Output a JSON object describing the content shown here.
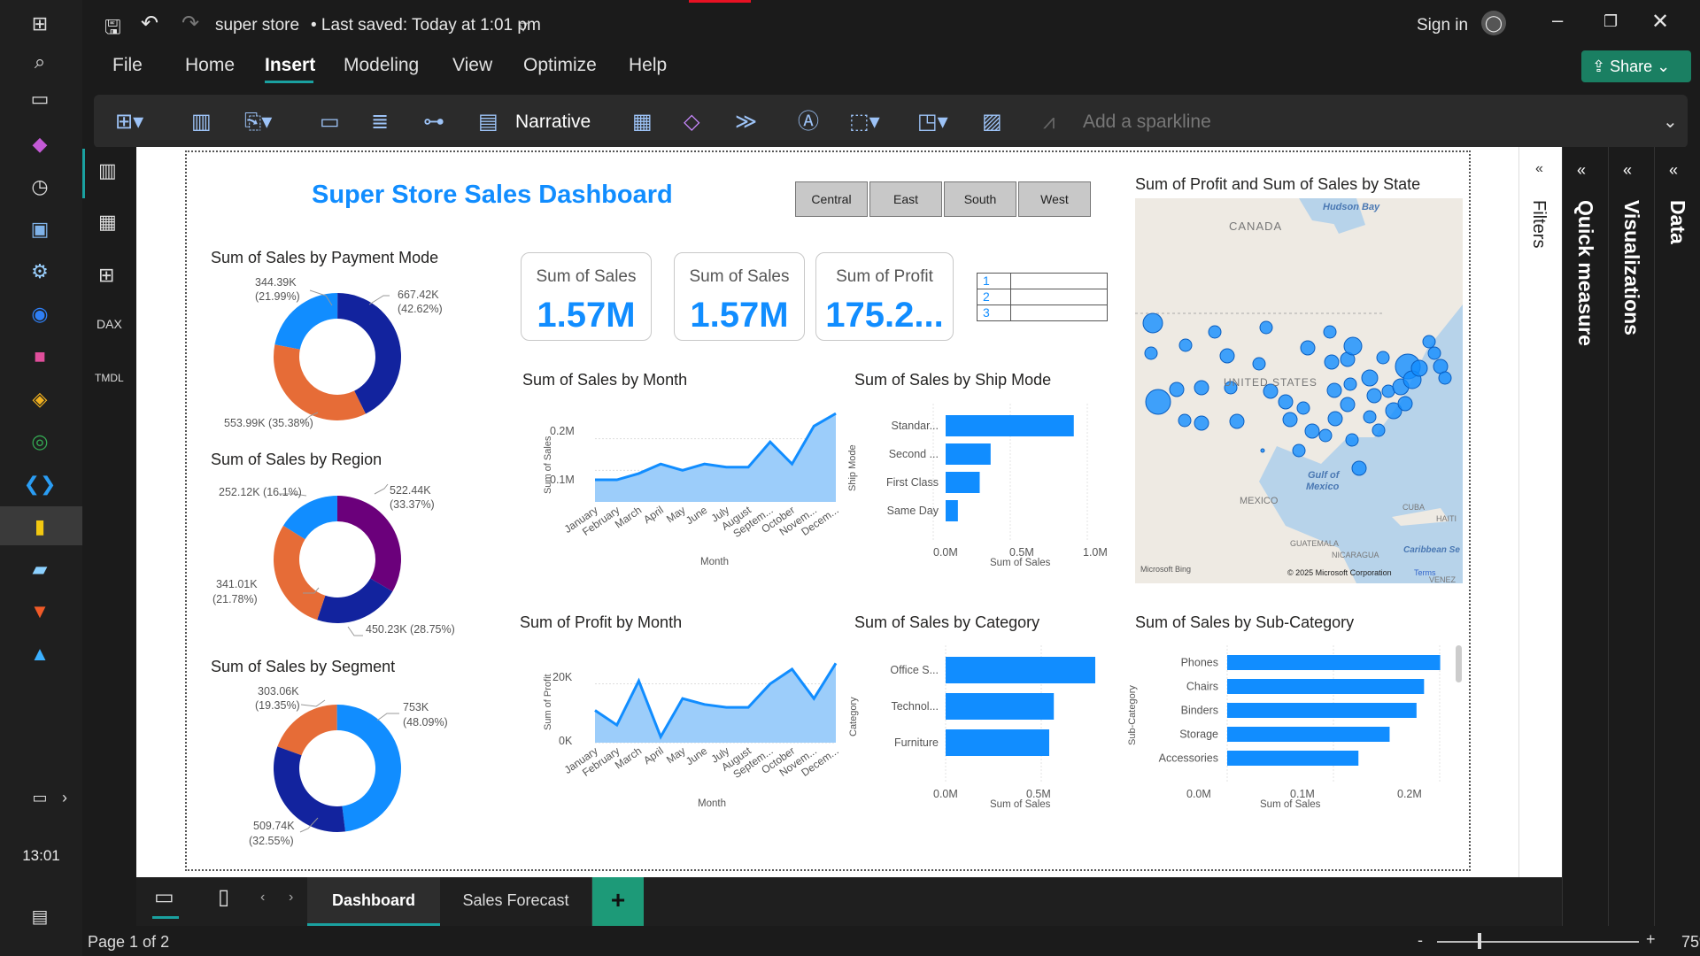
{
  "window": {
    "file_name": "super store",
    "saved_status": "• Last saved: Today at 1:01 pm",
    "sign_in": "Sign in",
    "share": "Share"
  },
  "menu": [
    "File",
    "Home",
    "Insert",
    "Modeling",
    "View",
    "Optimize",
    "Help"
  ],
  "ribbon": {
    "narrative": "Narrative",
    "sparkline": "Add a sparkline"
  },
  "taskbar": {
    "time": "13:01"
  },
  "panes": {
    "filters": "Filters",
    "quick_measure": "Quick measure",
    "visualizations": "Visualizations",
    "data": "Data"
  },
  "report": {
    "title": "Super Store Sales Dashboard",
    "slicer": [
      "Central",
      "East",
      "South",
      "West"
    ],
    "kpis": [
      {
        "label": "Sum of Sales",
        "value": "1.57M"
      },
      {
        "label": "Sum of Sales",
        "value": "1.57M"
      },
      {
        "label": "Sum of Profit",
        "value": "175.2..."
      }
    ],
    "table_rows": [
      "1",
      "2",
      "3"
    ],
    "payment": {
      "title": "Sum of Sales by Payment Mode",
      "labels": [
        "344.39K",
        "(21.99%)",
        "667.42K",
        "(42.62%)",
        "553.99K (35.38%)"
      ]
    },
    "region": {
      "title": "Sum of Sales by Region",
      "labels": [
        "252.12K (16.1%)",
        "522.44K",
        "(33.37%)",
        "341.01K",
        "(21.78%)",
        "450.23K (28.75%)"
      ]
    },
    "segment": {
      "title": "Sum of Sales by Segment",
      "labels": [
        "303.06K",
        "(19.35%)",
        "753K",
        "(48.09%)",
        "509.74K",
        "(32.55%)"
      ]
    },
    "sales_month": {
      "title": "Sum of Sales by Month",
      "ylabel": "Sum of Sales",
      "xlabel": "Month",
      "yticks": [
        "0.2M",
        "0.1M"
      ]
    },
    "profit_month": {
      "title": "Sum of Profit by Month",
      "ylabel": "Sum of Profit",
      "xlabel": "Month",
      "yticks": [
        "20K",
        "0K"
      ]
    },
    "ship": {
      "title": "Sum of Sales by Ship Mode",
      "ylabel": "Ship Mode",
      "xlabel": "Sum of Sales",
      "xticks": [
        "0.0M",
        "0.5M",
        "1.0M"
      ]
    },
    "category": {
      "title": "Sum of Sales by Category",
      "ylabel": "Category",
      "xlabel": "Sum of Sales",
      "xticks": [
        "0.0M",
        "0.5M"
      ]
    },
    "subcat": {
      "title": "Sum of Sales by Sub-Category",
      "ylabel": "Sub-Category",
      "xlabel": "Sum of Sales",
      "xticks": [
        "0.0M",
        "0.1M",
        "0.2M"
      ]
    },
    "map": {
      "title": "Sum of Profit and Sum of Sales by State",
      "labels": [
        "Hudson Bay",
        "CANADA",
        "UNITED STATES",
        "Gulf of",
        "Mexico",
        "MEXICO",
        "CUBA",
        "GUATEMALA",
        "NICARAGUA",
        "Caribbean Se",
        "VENEZ",
        "Microsoft Bing",
        "© 2025 Microsoft Corporation",
        "Terms",
        "HAITI"
      ]
    }
  },
  "tabs": [
    "Dashboard",
    "Sales Forecast"
  ],
  "status": {
    "page": "Page 1 of 2",
    "zoom": "75%",
    "zoom_minus": "-",
    "zoom_plus": "+"
  },
  "chart_data": [
    {
      "type": "pie",
      "title": "Sum of Sales by Payment Mode",
      "series": [
        {
          "values": [
            344.39,
            667.42,
            553.99
          ],
          "colors": [
            "#118dff",
            "#12239e",
            "#e66c37"
          ]
        }
      ]
    },
    {
      "type": "pie",
      "title": "Sum of Sales by Region",
      "series": [
        {
          "values": [
            252.12,
            522.44,
            341.01,
            450.23
          ],
          "colors": [
            "#118dff",
            "#6b007b",
            "#12239e",
            "#e66c37"
          ]
        }
      ]
    },
    {
      "type": "pie",
      "title": "Sum of Sales by Segment",
      "series": [
        {
          "values": [
            303.06,
            753,
            509.74
          ],
          "colors": [
            "#e66c37",
            "#118dff",
            "#12239e"
          ]
        }
      ]
    },
    {
      "type": "area",
      "title": "Sum of Sales by Month",
      "categories": [
        "January",
        "February",
        "March",
        "April",
        "May",
        "June",
        "July",
        "August",
        "Septem...",
        "October",
        "Novem...",
        "Decem..."
      ],
      "values": [
        0.07,
        0.07,
        0.09,
        0.12,
        0.1,
        0.12,
        0.11,
        0.11,
        0.19,
        0.12,
        0.24,
        0.28
      ],
      "ylim": [
        0,
        0.3
      ]
    },
    {
      "type": "area",
      "title": "Sum of Profit by Month",
      "categories": [
        "January",
        "February",
        "March",
        "April",
        "May",
        "June",
        "July",
        "August",
        "Septem...",
        "October",
        "Novem...",
        "Decem..."
      ],
      "values": [
        11000,
        6000,
        21000,
        2000,
        15000,
        13000,
        12000,
        12000,
        20000,
        25000,
        15000,
        27000
      ],
      "ylim": [
        0,
        31000
      ]
    },
    {
      "type": "bar",
      "title": "Sum of Sales by Ship Mode",
      "categories": [
        "Standar...",
        "Second ...",
        "First Class",
        "Same Day"
      ],
      "values": [
        0.94,
        0.33,
        0.25,
        0.09
      ],
      "xlim": [
        0,
        1.0
      ]
    },
    {
      "type": "bar",
      "title": "Sum of Sales by Category",
      "categories": [
        "Office S...",
        "Technol...",
        "Furniture"
      ],
      "values": [
        0.65,
        0.47,
        0.45
      ],
      "xlim": [
        0,
        0.7
      ]
    },
    {
      "type": "bar",
      "title": "Sum of Sales by Sub-Category",
      "categories": [
        "Phones",
        "Chairs",
        "Binders",
        "Storage",
        "Accessories"
      ],
      "values": [
        0.198,
        0.183,
        0.176,
        0.151,
        0.122
      ],
      "xlim": [
        0,
        0.2
      ]
    }
  ]
}
